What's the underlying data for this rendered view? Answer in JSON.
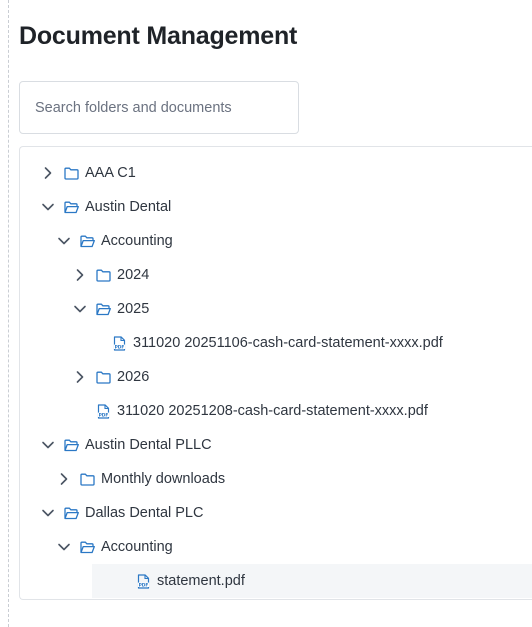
{
  "page_title": "Document Management",
  "search": {
    "placeholder": "Search folders and documents",
    "value": ""
  },
  "colors": {
    "icon_blue": "#2b78c5",
    "chevron": "#4b5563",
    "selected_row": "#f4f6f8"
  },
  "tree": [
    {
      "label": "AAA C1",
      "type": "folder",
      "expanded": false,
      "depth": 0
    },
    {
      "label": "Austin Dental",
      "type": "folder",
      "expanded": true,
      "depth": 0
    },
    {
      "label": "Accounting",
      "type": "folder",
      "expanded": true,
      "depth": 1
    },
    {
      "label": "2024",
      "type": "folder",
      "expanded": false,
      "depth": 2
    },
    {
      "label": "2025",
      "type": "folder",
      "expanded": true,
      "depth": 2
    },
    {
      "label": "311020 20251106-cash-card-statement-xxxx.pdf",
      "type": "pdf",
      "depth": 3
    },
    {
      "label": "2026",
      "type": "folder",
      "expanded": false,
      "depth": 2
    },
    {
      "label": "311020 20251208-cash-card-statement-xxxx.pdf",
      "type": "pdf",
      "depth": 2
    },
    {
      "label": "Austin Dental PLLC",
      "type": "folder",
      "expanded": true,
      "depth": 0
    },
    {
      "label": "Monthly downloads",
      "type": "folder",
      "expanded": false,
      "depth": 1
    },
    {
      "label": "Dallas Dental PLC",
      "type": "folder",
      "expanded": true,
      "depth": 0
    },
    {
      "label": "Accounting",
      "type": "folder",
      "expanded": true,
      "depth": 1
    },
    {
      "label": "statement.pdf",
      "type": "pdf",
      "depth": 2,
      "selected": true
    }
  ]
}
